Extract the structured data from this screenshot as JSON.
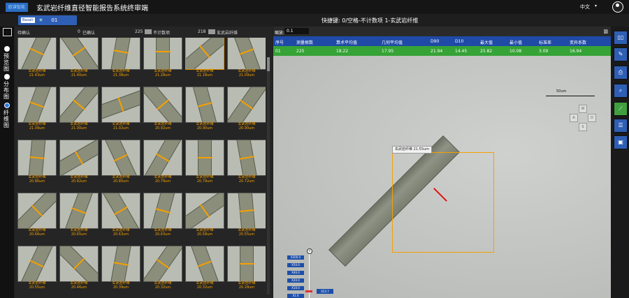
{
  "titlebar": {
    "logo": "欧谱智能",
    "title": "玄武岩纤维直径智能报告系统终审端",
    "language": "中文"
  },
  "toolbar": {
    "sample_tag": "Basalt",
    "sample_id": "01",
    "shortcut_text": "快捷键: 0/空格-不计数项 1-玄武岩纤维"
  },
  "leftrail": {
    "options": [
      {
        "label": "预览图"
      },
      {
        "label": "分布图"
      },
      {
        "label": "纤维图",
        "selected": true
      }
    ]
  },
  "thumbs": {
    "pending_label": "待确认",
    "pending_count": "0",
    "confirmed_label": "已确认",
    "confirmed_count": "225",
    "uncounted_label": "不计数项",
    "uncounted_count": "218",
    "fiber_label": "玄武岩纤维",
    "items": [
      {
        "name": "玄武岩纤维",
        "value": "21.43um"
      },
      {
        "name": "玄武岩纤维",
        "value": "21.40um"
      },
      {
        "name": "玄武岩纤维",
        "value": "21.38um"
      },
      {
        "name": "玄武岩纤维",
        "value": "21.28um"
      },
      {
        "name": "玄武岩纤维",
        "value": "21.18um"
      },
      {
        "name": "玄武岩纤维",
        "value": "21.09um"
      },
      {
        "name": "玄武岩纤维",
        "value": "21.09um"
      },
      {
        "name": "玄武岩纤维",
        "value": "21.00um"
      },
      {
        "name": "玄武岩纤维",
        "value": "21.02um"
      },
      {
        "name": "玄武岩纤维",
        "value": "20.92um"
      },
      {
        "name": "玄武岩纤维",
        "value": "20.90um"
      },
      {
        "name": "玄武岩纤维",
        "value": "20.90um"
      },
      {
        "name": "玄武岩纤维",
        "value": "20.86um"
      },
      {
        "name": "玄武岩纤维",
        "value": "20.82um"
      },
      {
        "name": "玄武岩纤维",
        "value": "20.80um"
      },
      {
        "name": "玄武岩纤维",
        "value": "20.79um"
      },
      {
        "name": "玄武岩纤维",
        "value": "20.79um"
      },
      {
        "name": "玄武岩纤维",
        "value": "20.72um"
      },
      {
        "name": "玄武岩纤维",
        "value": "20.66um"
      },
      {
        "name": "玄武岩纤维",
        "value": "20.65um"
      },
      {
        "name": "玄武岩纤维",
        "value": "20.63um"
      },
      {
        "name": "玄武岩纤维",
        "value": "20.63um"
      },
      {
        "name": "玄武岩纤维",
        "value": "20.58um"
      },
      {
        "name": "玄武岩纤维",
        "value": "20.55um"
      },
      {
        "name": "玄武岩纤维",
        "value": "20.55um"
      },
      {
        "name": "玄武岩纤维",
        "value": "20.46um"
      },
      {
        "name": "玄武岩纤维",
        "value": "20.39um"
      },
      {
        "name": "玄武岩纤维",
        "value": "20.32um"
      },
      {
        "name": "玄武岩纤维",
        "value": "20.32um"
      },
      {
        "name": "玄武岩纤维",
        "value": "20.28um"
      }
    ]
  },
  "viewer": {
    "zoom_label": "缩放:",
    "zoom_value": "0.1",
    "table": {
      "headers": [
        "序号",
        "测量根数",
        "算术平均值",
        "几何平均值",
        "D90",
        "D10",
        "最大值",
        "最小值",
        "标准差",
        "变异系数"
      ],
      "row": [
        "01",
        "225",
        "18.22",
        "17.95",
        "21.94",
        "14.45",
        "25.82",
        "10.08",
        "3.09",
        "16.94"
      ]
    },
    "annotation_label": "玄武岩纤维 21.55um",
    "scale_label": "50um",
    "dpad": [
      "W",
      "A",
      "S",
      "D"
    ],
    "zoom_ticks": [
      "X200.0",
      "X50.0",
      "X40.0",
      "X20.0",
      "X10.0",
      "X1.0"
    ],
    "zoom_current": "X23.7"
  }
}
